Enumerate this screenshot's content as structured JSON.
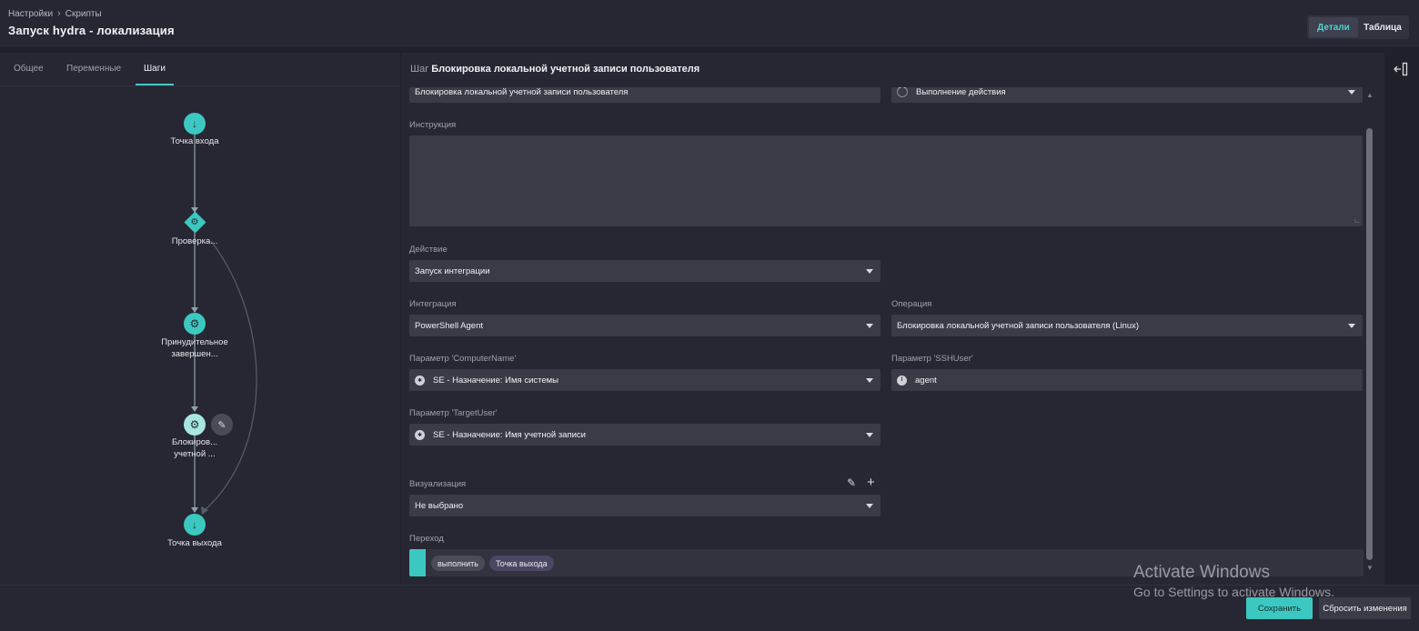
{
  "header": {
    "breadcrumbs": [
      "Настройки",
      "Скрипты"
    ],
    "title": "Запуск hydra - локализация",
    "view_toggle": {
      "details": "Детали",
      "table": "Таблица",
      "active": "details"
    }
  },
  "left_panel": {
    "tabs": [
      "Общее",
      "Переменные",
      "Шаги"
    ],
    "active_tab": "Шаги",
    "nodes": [
      {
        "label": "Точка входа",
        "icon": "arrow-down-icon"
      },
      {
        "label": "Проверка...",
        "icon": "gear-icon",
        "shape": "diamond"
      },
      {
        "label": "Принудительное завершен...",
        "icon": "gear-icon"
      },
      {
        "label": "Блокиров... учетной ...",
        "icon": "gear-icon",
        "selected": true
      },
      {
        "label": "Точка выхода",
        "icon": "arrow-down-icon"
      }
    ]
  },
  "step": {
    "prefix": "Шаг",
    "name": "Блокировка локальной учетной записи пользователя",
    "name_field": "Блокировка локальной учетной записи пользователя",
    "status": "Выполнение действия",
    "instruction_label": "Инструкция",
    "instruction_value": "",
    "action_label": "Действие",
    "action_value": "Запуск интеграции",
    "integration_label": "Интеграция",
    "integration_value": "PowerShell Agent",
    "operation_label": "Операция",
    "operation_value": "Блокировка локальной учетной записи пользователя (Linux)",
    "param_computername_label": "Параметр 'ComputerName'",
    "param_computername_value": "SE - Назначение: Имя системы",
    "param_sshuser_label": "Параметр 'SSHUser'",
    "param_sshuser_value": "agent",
    "param_targetuser_label": "Параметр 'TargetUser'",
    "param_targetuser_value": "SE - Назначение: Имя учетной записи",
    "visualization_label": "Визуализация",
    "visualization_value": "Не выбрано",
    "transition_label": "Переход",
    "transition_chips": [
      "выполнить",
      "Точка выхода"
    ]
  },
  "footer": {
    "save": "Сохранить",
    "reset": "Сбросить изменения"
  },
  "watermark": {
    "line1": "Activate Windows",
    "line2": "Go to Settings to activate Windows."
  },
  "colors": {
    "accent": "#3cc8c1",
    "background": "#1f2029",
    "panel": "#262733",
    "input": "#3a3b47"
  }
}
